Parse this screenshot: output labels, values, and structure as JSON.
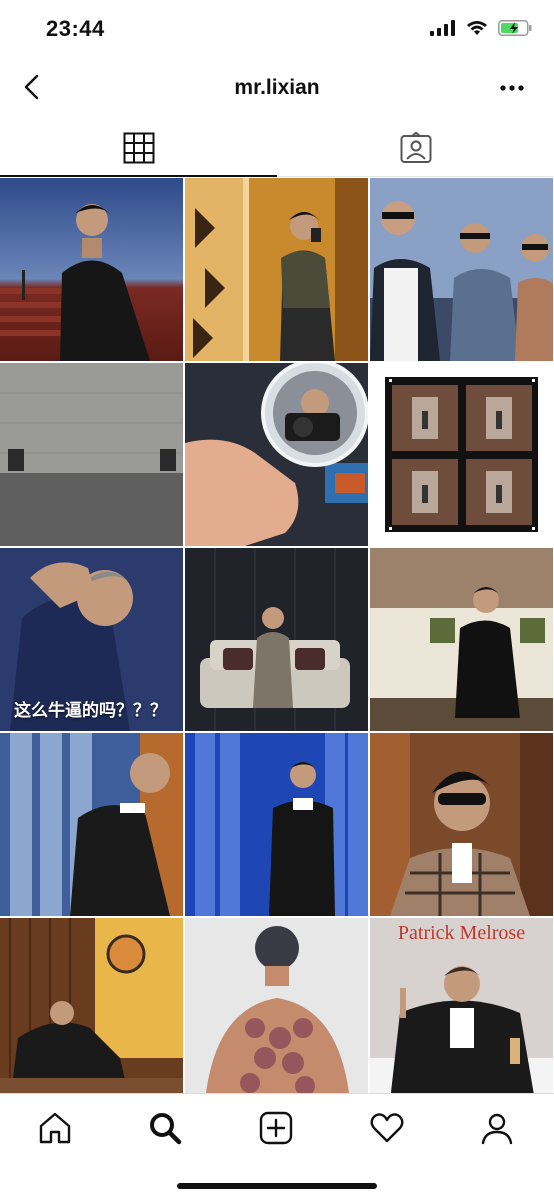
{
  "status": {
    "time": "23:44"
  },
  "profile": {
    "username": "mr.lixian"
  },
  "icons": {
    "back": "chevron-left-icon",
    "more": "more-dots-icon",
    "grid": "grid-icon",
    "tagged": "tagged-person-icon"
  },
  "tabs": [
    {
      "name": "grid",
      "active": true
    },
    {
      "name": "tagged",
      "active": false
    }
  ],
  "posts": [
    {
      "id": 1,
      "desc": "man in leather jacket on red stands"
    },
    {
      "id": 2,
      "desc": "mirror selfie in gold elevator"
    },
    {
      "id": 3,
      "desc": "three men in sunglasses"
    },
    {
      "id": 4,
      "desc": "concrete wall"
    },
    {
      "id": 5,
      "desc": "hand holding lens with camera reflection"
    },
    {
      "id": 6,
      "desc": "corridor photo film strip"
    },
    {
      "id": 7,
      "desc": "man touching head",
      "caption": "这么牛逼的吗？？？"
    },
    {
      "id": 8,
      "desc": "man in plaid suit on sofa"
    },
    {
      "id": 9,
      "desc": "man in tuxedo on sofa"
    },
    {
      "id": 10,
      "desc": "man in tuxedo by windows"
    },
    {
      "id": 11,
      "desc": "man in suit on blue"
    },
    {
      "id": 12,
      "desc": "man in sunglasses plaid coat"
    },
    {
      "id": 13,
      "desc": "man lounging in yellow room"
    },
    {
      "id": 14,
      "desc": "back with cupping marks"
    },
    {
      "id": 15,
      "desc": "man in bathtub poster",
      "overlay_title": "Patrick Melrose"
    }
  ],
  "bottom_nav": [
    {
      "name": "home",
      "icon": "home-icon"
    },
    {
      "name": "search",
      "icon": "search-icon",
      "active": true
    },
    {
      "name": "new-post",
      "icon": "plus-square-icon"
    },
    {
      "name": "activity",
      "icon": "heart-icon"
    },
    {
      "name": "profile",
      "icon": "profile-icon"
    }
  ],
  "colors": {
    "text": "#111111",
    "divider": "#e5e5e5",
    "battery": "#4cd964"
  }
}
